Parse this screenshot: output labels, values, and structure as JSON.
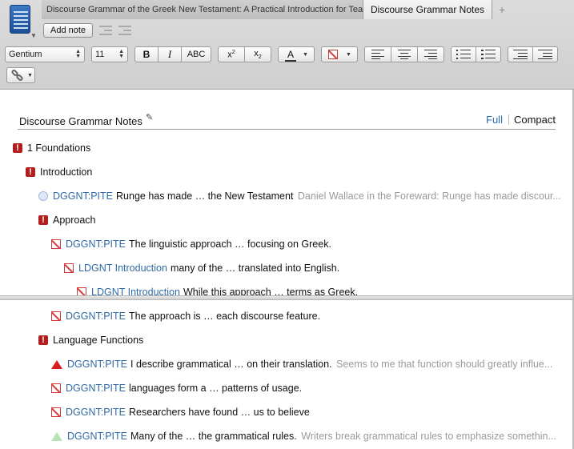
{
  "tabs": [
    {
      "label": "Discourse Grammar of the Greek New Testament: A Practical Introduction for Teaching and Exegesis"
    },
    {
      "label": "Discourse Grammar Notes"
    },
    {
      "label": "+"
    }
  ],
  "toolbar": {
    "add_note": "Add note",
    "font_name": "Gentium",
    "font_size": "11",
    "bold": "B",
    "italic": "I",
    "smallcaps": "ABC",
    "superscript": "x2",
    "subscript": "x2",
    "font_color_label": "A",
    "accent_color": "#c43c3c"
  },
  "document": {
    "title": "Discourse Grammar Notes",
    "view_full": "Full",
    "view_compact": "Compact"
  },
  "notes": [
    {
      "icon": "exclamation",
      "ref": "",
      "text": "1 Foundations",
      "note": ""
    },
    {
      "icon": "exclamation",
      "ref": "",
      "text": "Introduction",
      "note": ""
    },
    {
      "icon": "circle",
      "ref": "DGGNT:PITE",
      "text": "Runge has made … the New Testament",
      "note": "Daniel Wallace in the Foreward: Runge has made discour..."
    },
    {
      "icon": "exclamation",
      "ref": "",
      "text": "Approach",
      "note": ""
    },
    {
      "icon": "no-entry",
      "ref": "DGGNT:PITE",
      "text": "The linguistic approach … focusing on Greek.",
      "note": ""
    },
    {
      "icon": "no-entry",
      "ref": "LDGNT Introduction",
      "text": "many of the … translated into English.",
      "note": ""
    },
    {
      "icon": "no-entry",
      "ref": "LDGNT Introduction",
      "text": "While this approach … terms as Greek.",
      "note": ""
    },
    {
      "icon": "no-entry",
      "ref": "DGGNT:PITE",
      "text": "The approach is … each discourse feature.",
      "note": ""
    },
    {
      "icon": "exclamation",
      "ref": "",
      "text": "Language Functions",
      "note": ""
    },
    {
      "icon": "triangle-red",
      "ref": "DGGNT:PITE",
      "text": "I describe grammatical … on their translation.",
      "note": "Seems to me that function should greatly influe..."
    },
    {
      "icon": "no-entry",
      "ref": "DGGNT:PITE",
      "text": "languages form a … patterns of usage.",
      "note": ""
    },
    {
      "icon": "no-entry",
      "ref": "DGGNT:PITE",
      "text": "Researchers have found … us to believe",
      "note": ""
    },
    {
      "icon": "triangle-green",
      "ref": "DGGNT:PITE",
      "text": "Many of the … the grammatical rules.",
      "note": "Writers break grammatical rules to emphasize somethin..."
    }
  ]
}
